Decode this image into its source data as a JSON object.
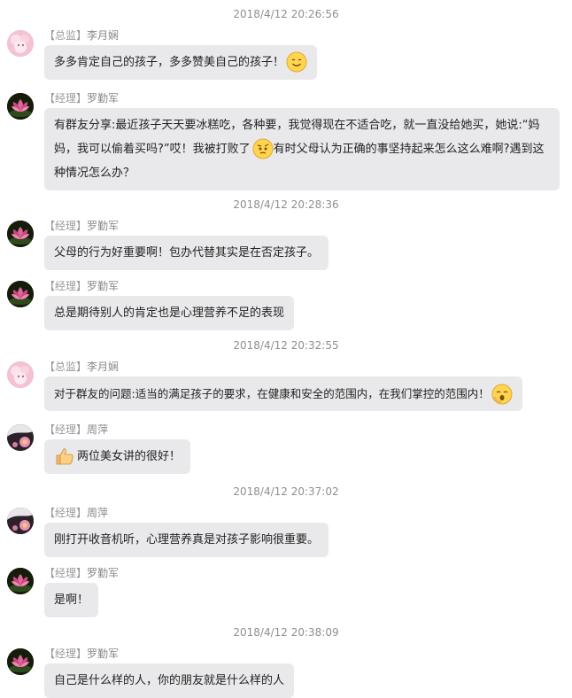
{
  "timestamps": [
    "2018/4/12 20:26:56",
    "2018/4/12 20:28:36",
    "2018/4/12 20:32:55",
    "2018/4/12 20:37:02",
    "2018/4/12 20:38:09"
  ],
  "messages": [
    {
      "role": "【总监】",
      "name": "李月娴",
      "avatar": "pink-flower-avatar",
      "text": "多多肯定自己的孩子，多多赞美自己的孩子！",
      "emoji": "smile-emoji"
    },
    {
      "role": "【经理】",
      "name": "罗勤军",
      "avatar": "lotus-avatar",
      "text_a": "有群友分享:最近孩子天天要冰糕吃，各种要，我觉得现在不适合吃，就一直没给她买，她说:“妈妈，我可以偷着买吗?”哎！我被打败了",
      "emoji": "doubt-emoji",
      "text_b": "有时父母认为正确的事坚持起来怎么这么难啊?遇到这种情况怎么办？"
    },
    {
      "role": "【经理】",
      "name": "罗勤军",
      "avatar": "lotus-avatar",
      "text": "父母的行为好重要啊！包办代替其实是在否定孩子。"
    },
    {
      "role": "【经理】",
      "name": "罗勤军",
      "avatar": "lotus-avatar",
      "text": "总是期待别人的肯定也是心理营养不足的表现"
    },
    {
      "role": "【总监】",
      "name": "李月娴",
      "avatar": "pink-flower-avatar",
      "text": "对于群友的问题:适当的满足孩子的要求，在健康和安全的范围内，在我们掌控的范围内！",
      "emoji": "yawn-emoji"
    },
    {
      "role": "【经理】",
      "name": "周萍",
      "avatar": "dark-flower-avatar",
      "emoji": "thumbs-up-emoji",
      "text": "两位美女讲的很好！"
    },
    {
      "role": "【经理】",
      "name": "周萍",
      "avatar": "dark-flower-avatar",
      "text": "刚打开收音机听，心理营养真是对孩子影响很重要。"
    },
    {
      "role": "【经理】",
      "name": "罗勤军",
      "avatar": "lotus-avatar",
      "text": "是啊！"
    },
    {
      "role": "【经理】",
      "name": "罗勤军",
      "avatar": "lotus-avatar",
      "text": "自己是什么样的人，你的朋友就是什么样的人"
    }
  ]
}
